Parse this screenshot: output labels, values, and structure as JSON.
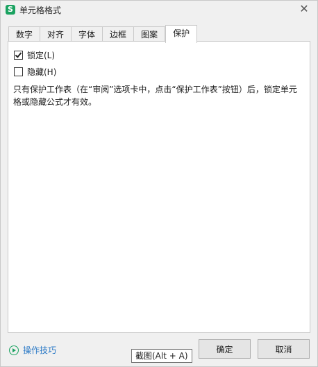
{
  "window": {
    "app_icon_letter": "S",
    "title": "单元格格式",
    "close_symbol": "✕"
  },
  "tabs": [
    {
      "label": "数字"
    },
    {
      "label": "对齐"
    },
    {
      "label": "字体"
    },
    {
      "label": "边框"
    },
    {
      "label": "图案"
    },
    {
      "label": "保护",
      "active": true
    }
  ],
  "protection": {
    "locked": {
      "label": "锁定(L)",
      "checked": true
    },
    "hidden": {
      "label": "隐藏(H)",
      "checked": false
    },
    "description": "只有保护工作表（在“审阅”选项卡中，点击“保护工作表”按钮）后，锁定单元格或隐藏公式才有效。"
  },
  "footer": {
    "tips_label": "操作技巧",
    "ok_label": "确定",
    "cancel_label": "取消"
  },
  "tooltip": {
    "text": "截图(Alt + A)"
  },
  "colors": {
    "accent_green": "#1aa260",
    "link_blue": "#2a79c6"
  }
}
